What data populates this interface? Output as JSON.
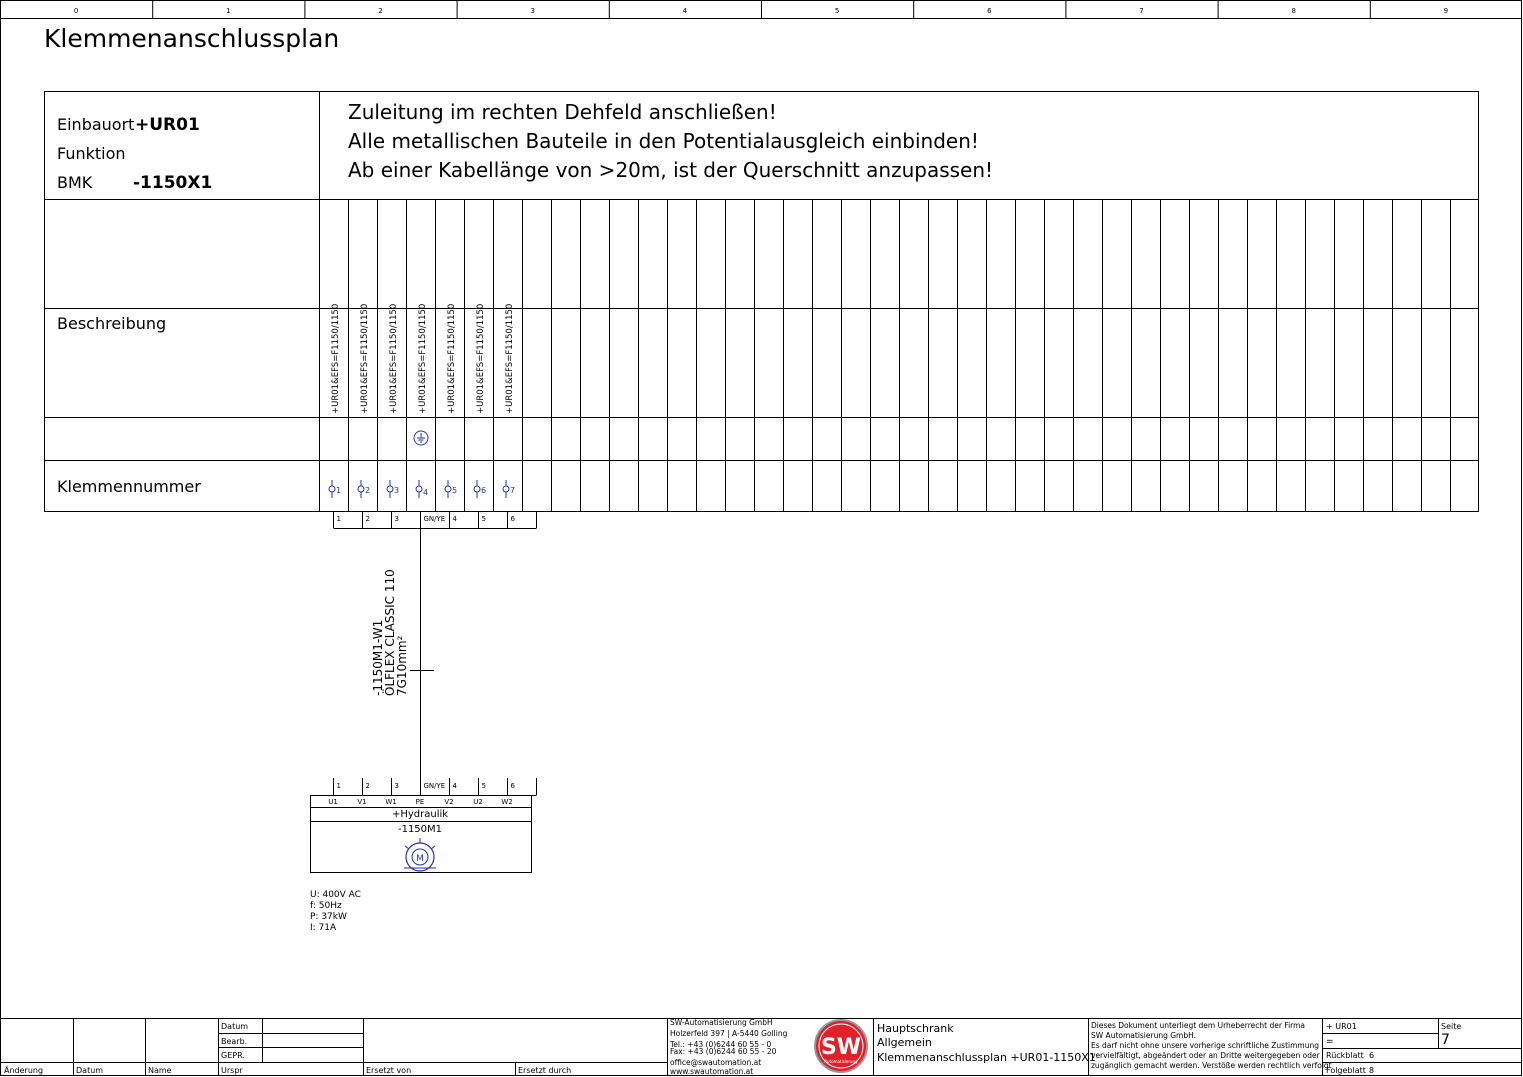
{
  "column_ruler": [
    "0",
    "1",
    "2",
    "3",
    "4",
    "5",
    "6",
    "7",
    "8",
    "9"
  ],
  "page_title": "Klemmenanschlussplan",
  "header": {
    "einbauort_label": "Einbauort",
    "einbauort_value": "+UR01",
    "funktion_label": "Funktion",
    "bmk_label": "BMK",
    "bmk_value": "-1150X1"
  },
  "notes": [
    "Zuleitung im rechten Dehfeld anschließen!",
    "Alle metallischen Bauteile in den Potentialausgleich einbinden!",
    "Ab einer Kabellänge von >20m, ist der Querschnitt anzupassen!"
  ],
  "row_labels": {
    "beschreibung": "Beschreibung",
    "klemmennummer": "Klemmennummer"
  },
  "terminals": [
    {
      "desc": "+UR01&EFS=F1150/1150",
      "number": "1",
      "pe": false
    },
    {
      "desc": "+UR01&EFS=F1150/1150",
      "number": "2",
      "pe": false
    },
    {
      "desc": "+UR01&EFS=F1150/1150",
      "number": "3",
      "pe": false
    },
    {
      "desc": "+UR01&EFS=F1150/1150",
      "number": "4",
      "pe": true
    },
    {
      "desc": "+UR01&EFS=F1150/1150",
      "number": "5",
      "pe": false
    },
    {
      "desc": "+UR01&EFS=F1150/1150",
      "number": "6",
      "pe": false
    },
    {
      "desc": "+UR01&EFS=F1150/1150",
      "number": "7",
      "pe": false
    }
  ],
  "wire_cores": [
    "1",
    "2",
    "3",
    "GN/YE",
    "4",
    "5",
    "6"
  ],
  "cable": {
    "name": "-1150M1-W1",
    "type": "ÖLFLEX CLASSIC 110",
    "section": "7G10mm²"
  },
  "motor": {
    "pins": [
      "U1",
      "V1",
      "W1",
      "PE",
      "V2",
      "U2",
      "W2"
    ],
    "location": "+Hydraulik",
    "bmk": "-1150M1",
    "specs": [
      "U: 400V AC",
      "f: 50Hz",
      "P: 37kW",
      "I: 71A"
    ]
  },
  "title_block": {
    "datum": "Datum",
    "bearb": "Bearb.",
    "gepr": "GEPR.",
    "aenderung": "Änderung",
    "datum2": "Datum",
    "name": "Name",
    "urspr": "Urspr",
    "ersetzt_von": "Ersetzt von",
    "ersetzt_durch": "Ersetzt durch",
    "company_lines": [
      "SW-Automatisierung GmbH",
      "Holzerfeld 397 | A-5440 Golling",
      "Tel.: +43 (0)6244 60 55 - 0",
      "Fax: +43 (0)6244 60 55 - 20",
      "office@swautomation.at",
      "www.swautomation.at"
    ],
    "logo_text": "SW",
    "logo_sub": "Automatisierung",
    "plan_lines": [
      "Hauptschrank",
      "Allgemein",
      "Klemmenanschlussplan +UR01-1150X1"
    ],
    "copyright_lines": [
      "Dieses Dokument unterliegt dem Urheberrecht der Firma",
      "SW Automatisierung GmbH.",
      "Es darf nicht ohne unsere vorherige schriftliche Zustimmung",
      "vervielfältigt, abgeändert oder an Dritte weitergegeben oder",
      "zugänglich gemacht werden. Verstöße werden rechtlich verfolgt"
    ],
    "location_value": "+ UR01",
    "eq": "=",
    "rueckblatt_label": "Rückblatt",
    "rueckblatt_value": "6",
    "folgeblatt_label": "Folgeblatt",
    "folgeblatt_value": "8",
    "seite_label": "Seite",
    "seite_value": "7"
  }
}
